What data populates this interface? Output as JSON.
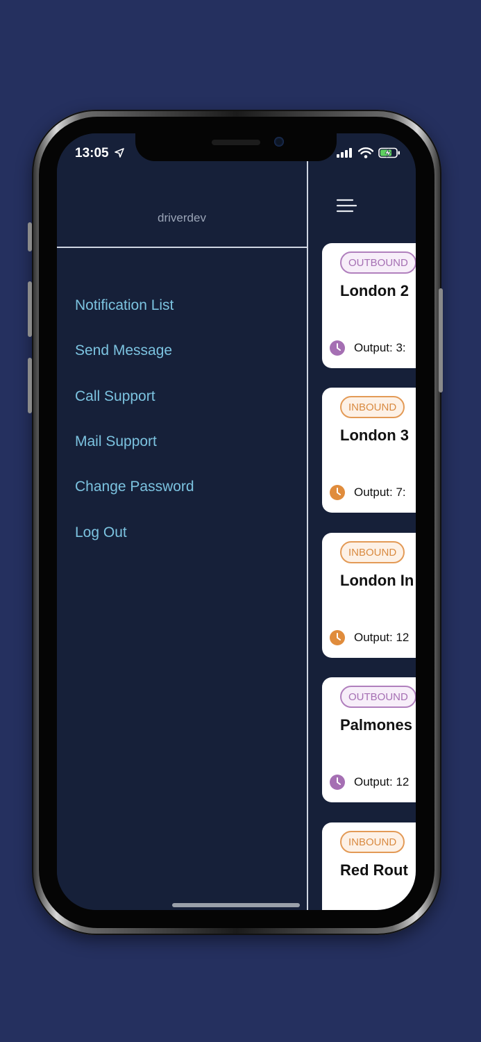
{
  "status": {
    "time": "13:05"
  },
  "drawer": {
    "username": "driverdev",
    "menu": [
      {
        "label": "Notification List"
      },
      {
        "label": "Send Message"
      },
      {
        "label": "Call Support"
      },
      {
        "label": "Mail Support"
      },
      {
        "label": "Change Password"
      },
      {
        "label": "Log Out"
      }
    ]
  },
  "cards": [
    {
      "badge": "OUTBOUND",
      "type": "outbound",
      "title": "London 2",
      "output": "Output: 3:"
    },
    {
      "badge": "INBOUND",
      "type": "inbound",
      "title": "London 3",
      "output": "Output: 7:"
    },
    {
      "badge": "INBOUND",
      "type": "inbound",
      "title": "London In",
      "output": "Output: 12"
    },
    {
      "badge": "OUTBOUND",
      "type": "outbound",
      "title": "Palmones",
      "output": "Output: 12"
    },
    {
      "badge": "INBOUND",
      "type": "inbound",
      "title": "Red Rout",
      "output": ""
    }
  ],
  "colors": {
    "background": "#25305f",
    "drawer": "#162039",
    "menu_text": "#7cc3e0",
    "outbound": "#a56fb3",
    "inbound": "#d98a40"
  },
  "icons": [
    "location-arrow-icon",
    "signal-icon",
    "wifi-icon",
    "battery-charging-icon",
    "hamburger-menu-icon",
    "clock-icon"
  ]
}
